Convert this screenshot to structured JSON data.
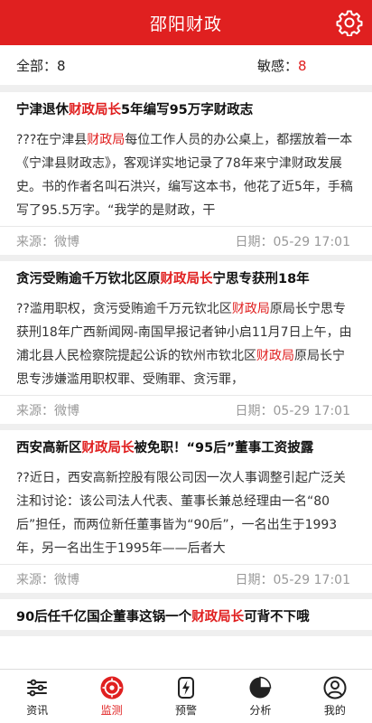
{
  "header": {
    "title": "邵阳财政"
  },
  "counts": {
    "all_label": "全部：",
    "all_value": "8",
    "sensitive_label": "敏感：",
    "sensitive_value": "8"
  },
  "articles": [
    {
      "title": [
        {
          "t": "宁津退休",
          "h": false
        },
        {
          "t": "财政局长",
          "h": true
        },
        {
          "t": "5年编写95万字财政志",
          "h": false
        }
      ],
      "body": [
        {
          "t": "???在宁津县",
          "h": false
        },
        {
          "t": "财政局",
          "h": true
        },
        {
          "t": "每位工作人员的办公桌上，都摆放着一本《宁津县财政志》，客观详实地记录了78年来宁津财政发展史。书的作者名叫石洪兴，编写这本书，他花了近5年，手稿写了95.5万字。“我学的是财政，干",
          "h": false
        }
      ],
      "source": "来源：微博",
      "date": "日期：05-29 17:01"
    },
    {
      "title": [
        {
          "t": "贪污受贿逾千万钦北区原",
          "h": false
        },
        {
          "t": "财政局长",
          "h": true
        },
        {
          "t": "宁思专获刑18年",
          "h": false
        }
      ],
      "body": [
        {
          "t": "??滥用职权，贪污受贿逾千万元钦北区",
          "h": false
        },
        {
          "t": "财政局",
          "h": true
        },
        {
          "t": "原局长宁思专获刑18年广西新闻网-南国早报记者钟小启11月7日上午，由浦北县人民检察院提起公诉的钦州市钦北区",
          "h": false
        },
        {
          "t": "财政局",
          "h": true
        },
        {
          "t": "原局长宁思专涉嫌滥用职权罪、受贿罪、贪污罪，",
          "h": false
        }
      ],
      "source": "来源：微博",
      "date": "日期：05-29 17:01"
    },
    {
      "title": [
        {
          "t": "西安高新区",
          "h": false
        },
        {
          "t": "财政局长",
          "h": true
        },
        {
          "t": "被免职！“95后”董事工资披露",
          "h": false
        }
      ],
      "body": [
        {
          "t": "??近日，西安高新控股有限公司因一次人事调整引起广泛关注和讨论：该公司法人代表、董事长兼总经理由一名“80后”担任，而两位新任董事皆为“90后”，一名出生于1993年，另一名出生于1995年——后者大",
          "h": false
        }
      ],
      "source": "来源：微博",
      "date": "日期：05-29 17:01"
    },
    {
      "title": [
        {
          "t": "90后任千亿国企董事这锅一个",
          "h": false
        },
        {
          "t": "财政局长",
          "h": true
        },
        {
          "t": "可背不下哦",
          "h": false
        }
      ],
      "body": [],
      "source": "",
      "date": ""
    }
  ],
  "tabs": [
    {
      "label": "资讯",
      "icon": "sliders-icon"
    },
    {
      "label": "监测",
      "icon": "target-icon"
    },
    {
      "label": "预警",
      "icon": "bolt-icon"
    },
    {
      "label": "分析",
      "icon": "pie-chart-icon"
    },
    {
      "label": "我的",
      "icon": "user-icon"
    }
  ],
  "colors": {
    "brand": "#e02020",
    "highlight": "#e02020"
  }
}
